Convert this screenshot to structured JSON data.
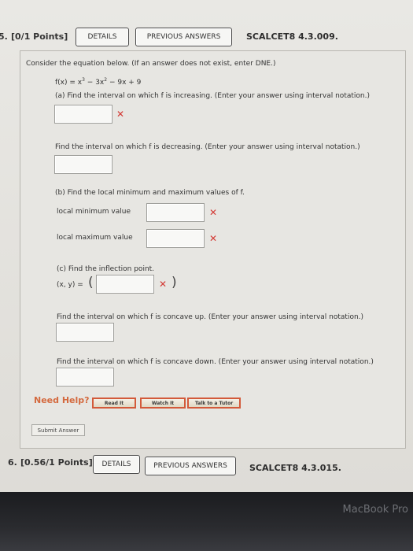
{
  "q5": {
    "number": "5.",
    "points": "[0/1 Points]",
    "details": "DETAILS",
    "previous": "PREVIOUS ANSWERS",
    "code": "SCALCET8 4.3.009."
  },
  "problem": {
    "intro": "Consider the equation below. (If an answer does not exist, enter DNE.)",
    "equation_lhs": "f(x) = x",
    "equation_exp1": "3",
    "equation_mid": " − 3x",
    "equation_exp2": "2",
    "equation_end": " − 9x + 9",
    "part_a": "(a) Find the interval on which f is increasing. (Enter your answer using interval notation.)",
    "decreasing": "Find the interval on which f is decreasing. (Enter your answer using interval notation.)",
    "part_b": "(b) Find the local minimum and maximum values of f.",
    "local_min": "local minimum value",
    "local_max": "local maximum value",
    "part_c": "(c) Find the inflection point.",
    "xy_label": "(x, y) =",
    "concave_up": "Find the interval on which f is concave up. (Enter your answer using interval notation.)",
    "concave_down": "Find the interval on which f is concave down. (Enter your answer using interval notation.)",
    "wrong_mark": "✕"
  },
  "help": {
    "label": "Need Help?",
    "read": "Read It",
    "watch": "Watch It",
    "tutor": "Talk to a Tutor"
  },
  "submit": "Submit Answer",
  "q6": {
    "number": "6.",
    "points": "[0.56/1 Points]",
    "details": "DETAILS",
    "previous": "PREVIOUS ANSWERS",
    "code": "SCALCET8 4.3.015."
  },
  "bezel_text": "MacBook Pro"
}
